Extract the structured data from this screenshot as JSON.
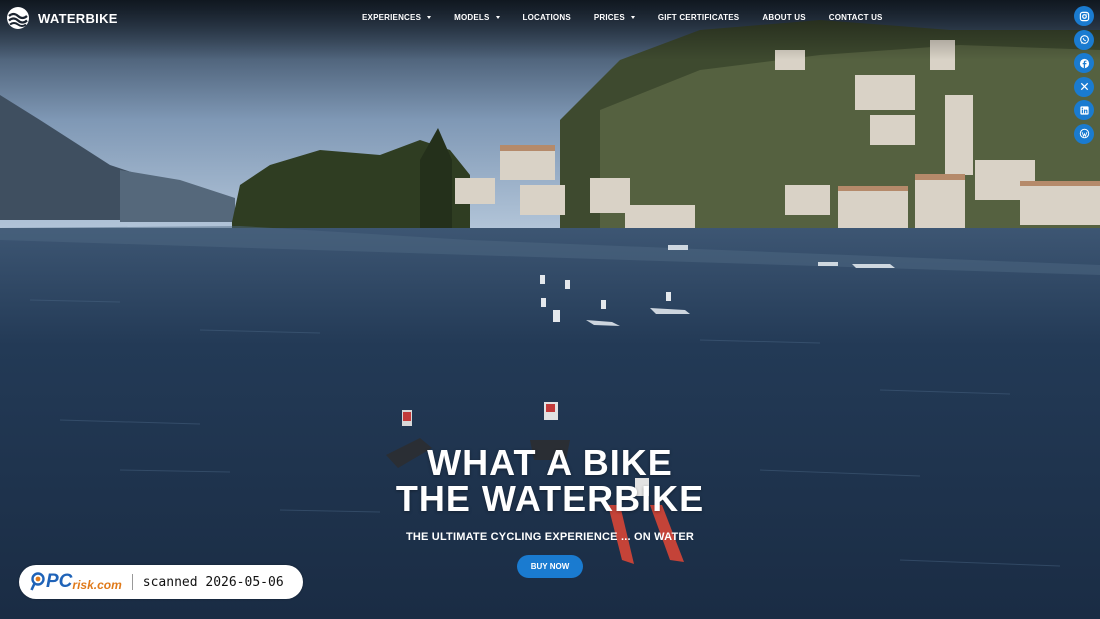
{
  "brand": {
    "name": "WATERBIKE"
  },
  "nav": {
    "items": [
      {
        "label": "EXPERIENCES",
        "dropdown": true
      },
      {
        "label": "MODELS",
        "dropdown": true
      },
      {
        "label": "LOCATIONS",
        "dropdown": false
      },
      {
        "label": "PRICES",
        "dropdown": true
      },
      {
        "label": "GIFT CERTIFICATES",
        "dropdown": false
      },
      {
        "label": "ABOUT US",
        "dropdown": false
      },
      {
        "label": "CONTACT US",
        "dropdown": false
      }
    ]
  },
  "social": [
    "instagram-icon",
    "whatsapp-icon",
    "facebook-icon",
    "x-icon",
    "linkedin-icon",
    "wordpress-icon"
  ],
  "hero": {
    "title_line1": "WHAT A BIKE",
    "title_line2": "THE WATERBIKE",
    "subtitle": "THE ULTIMATE CYCLING EXPERIENCE ... ON WATER",
    "cta": "BUY NOW"
  },
  "overlay": {
    "brand": "PC",
    "brand_suffix": "risk.com",
    "scan_text": "scanned 2026-05-06"
  },
  "colors": {
    "accent": "#1a7bd0",
    "water": "#1d3148",
    "sky": "#a9bfd6"
  }
}
